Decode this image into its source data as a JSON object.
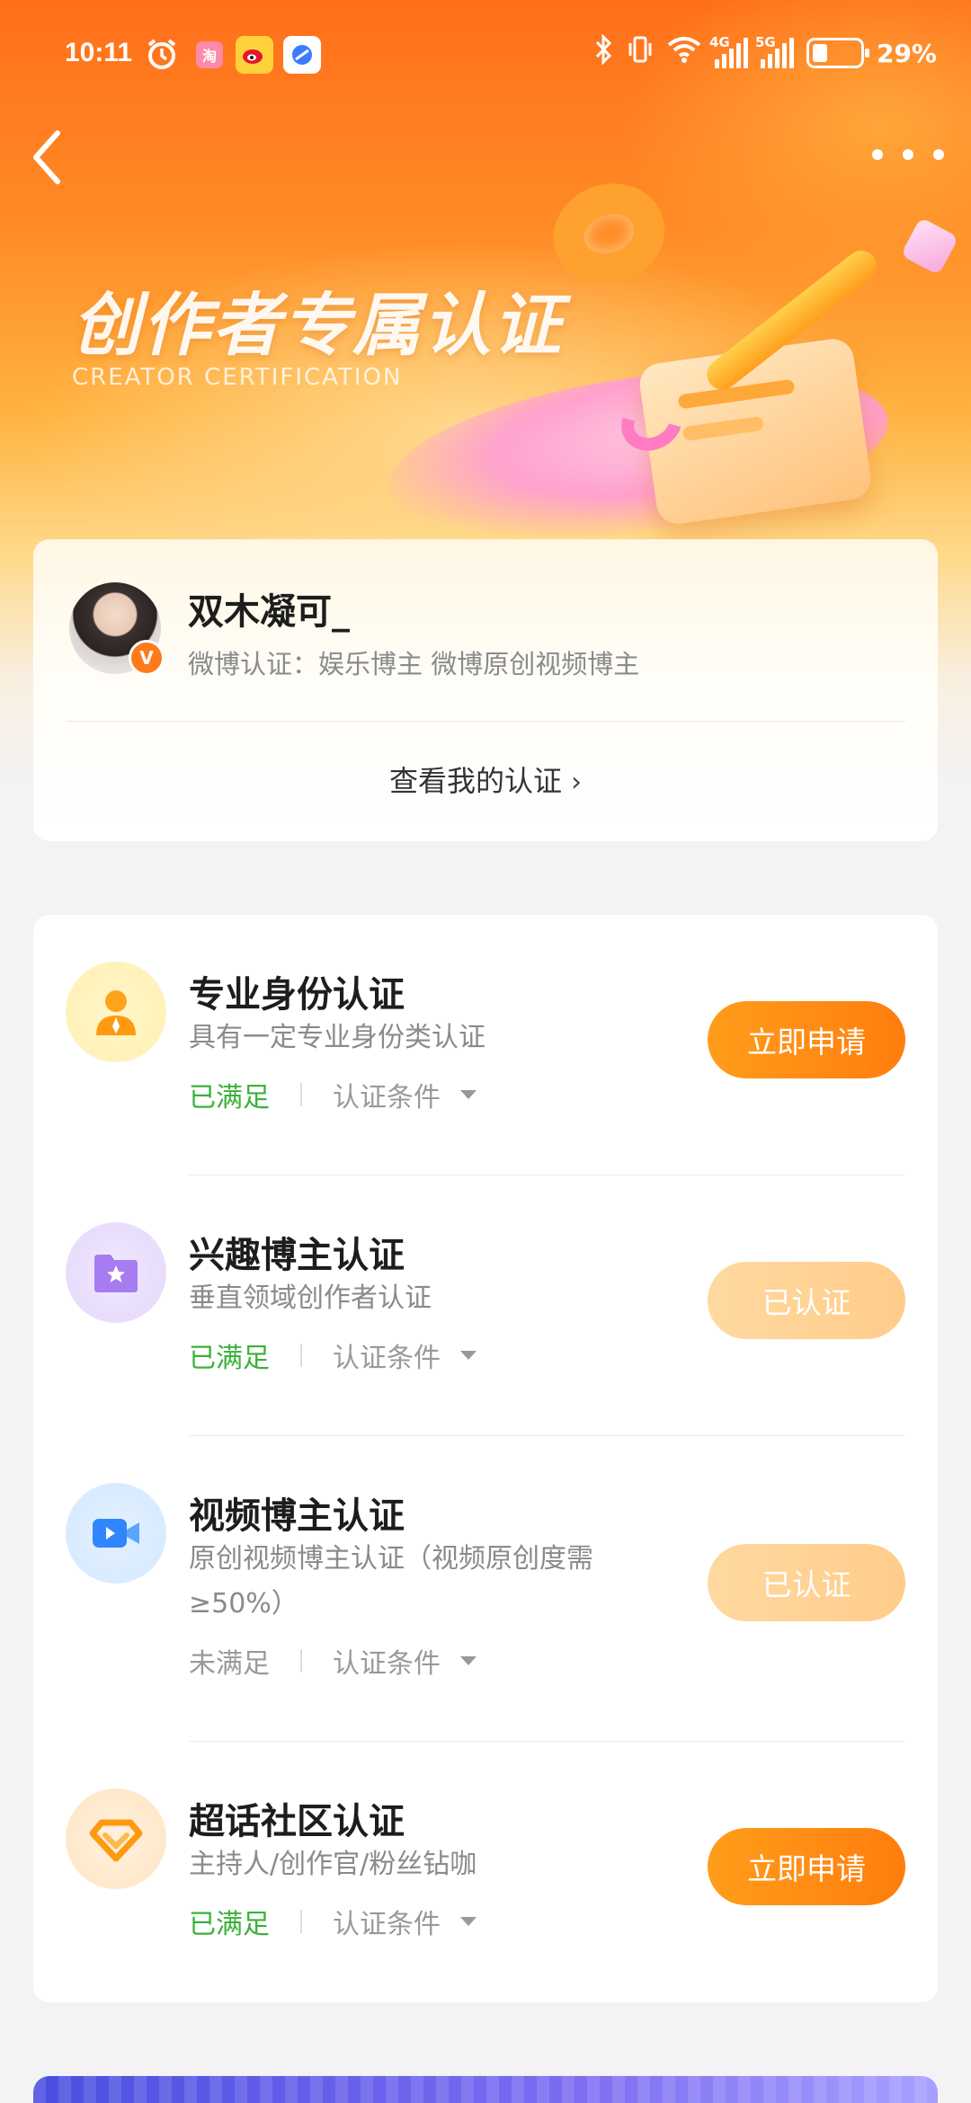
{
  "status_bar": {
    "time": "10:11",
    "app1": "淘",
    "battery": "29%",
    "net1": "4G",
    "net2": "5G"
  },
  "header": {
    "title": "创作者专属认证",
    "subtitle": "CREATOR CERTIFICATION"
  },
  "profile": {
    "name": "双木凝可_",
    "verification": "微博认证：娱乐博主 微博原创视频博主",
    "badge": "V",
    "view_link": "查看我的认证",
    "view_chevron": "›"
  },
  "certifications": [
    {
      "title": "专业身份认证",
      "desc": "具有一定专业身份类认证",
      "status": "已满足",
      "condition": "认证条件",
      "button": "立即申请",
      "icon": "person-icon"
    },
    {
      "title": "兴趣博主认证",
      "desc": "垂直领域创作者认证",
      "status": "已满足",
      "condition": "认证条件",
      "button": "已认证",
      "icon": "star-folder-icon"
    },
    {
      "title": "视频博主认证",
      "desc": "原创视频博主认证（视频原创度需≥50%）",
      "status": "未满足",
      "condition": "认证条件",
      "button": "已认证",
      "icon": "video-camera-icon"
    },
    {
      "title": "超话社区认证",
      "desc": "主持人/创作官/粉丝钻咖",
      "status": "已满足",
      "condition": "认证条件",
      "button": "立即申请",
      "icon": "diamond-icon"
    }
  ],
  "colors": {
    "accent": "#ff8a1a",
    "satisfied": "#3bb13b",
    "unsatisfied": "#999999",
    "button_disabled": "#ffd49a"
  }
}
